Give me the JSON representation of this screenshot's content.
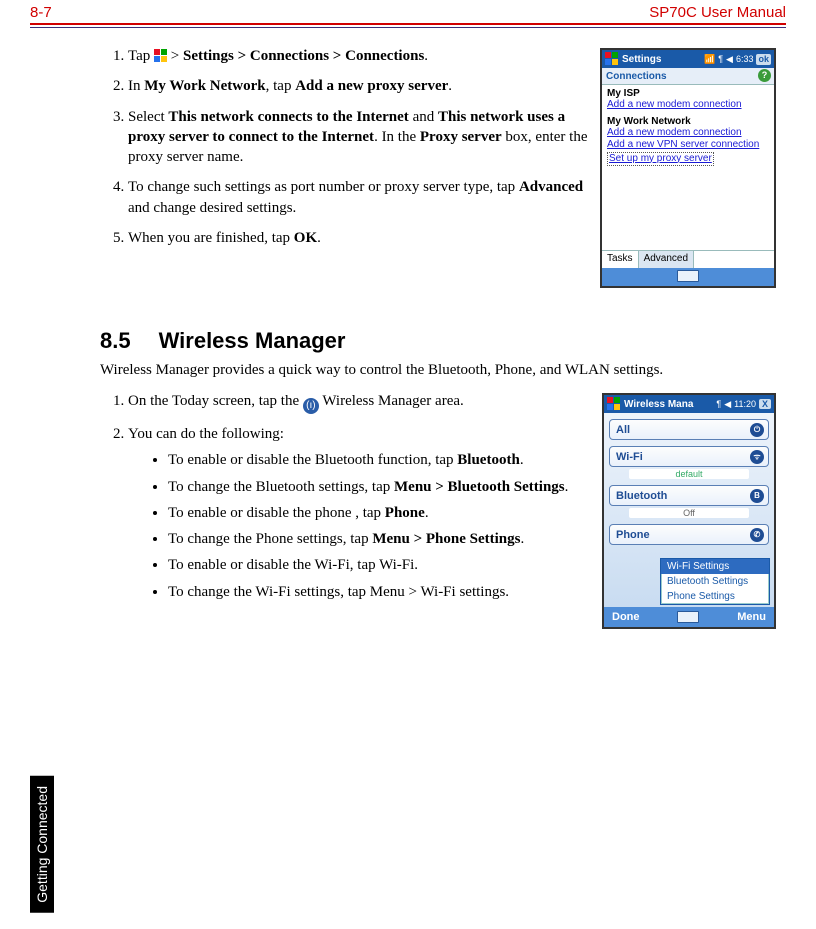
{
  "header": {
    "page": "8-7",
    "title": "SP70C User Manual"
  },
  "side_tab": "Getting Connected",
  "section1": {
    "steps": {
      "s1": {
        "pre": "Tap ",
        "post": " > ",
        "b1": "Settings > Connections > Connections",
        "end": "."
      },
      "s2": {
        "pre": "In ",
        "b1": "My Work Network",
        "mid": ", tap ",
        "b2": "Add a new proxy server",
        "end": "."
      },
      "s3": {
        "pre": "Select ",
        "b1": "This network connects to the Internet",
        "mid1": " and ",
        "b2": "This network uses a proxy server to connect to the Internet",
        "mid2": ". In the ",
        "b3": "Proxy server",
        "end": " box, enter the proxy server name."
      },
      "s4": {
        "pre": "To change such settings as port number or proxy server type, tap ",
        "b1": "Advanced",
        "end": " and change desired settings."
      },
      "s5": {
        "pre": "When you are finished, tap ",
        "b1": "OK",
        "end": "."
      }
    }
  },
  "section2": {
    "num": "8.5",
    "title": "Wireless Manager",
    "intro": "Wireless Manager provides a quick way to control the Bluetooth, Phone, and WLAN settings.",
    "steps": {
      "s1": {
        "pre": "On the Today screen, tap the ",
        "post": " Wireless Manager area."
      },
      "s2": {
        "text": "You can do the following:"
      }
    },
    "bullets": {
      "b1": {
        "pre": "To enable or disable the Bluetooth function, tap ",
        "bold": "Bluetooth",
        "end": "."
      },
      "b2": {
        "pre": "To change the Bluetooth settings, tap ",
        "bold": "Menu > Bluetooth Settings",
        "end": "."
      },
      "b3": {
        "pre": "To enable or disable the phone , tap ",
        "bold": "Phone",
        "end": "."
      },
      "b4": {
        "pre": "To change the Phone settings, tap ",
        "bold": "Menu > Phone Settings",
        "end": "."
      },
      "b5": {
        "text": "To enable or disable the Wi-Fi, tap Wi-Fi."
      },
      "b6": {
        "text": "To change the Wi-Fi settings, tap Menu > Wi-Fi settings."
      }
    }
  },
  "shot1": {
    "title": "Settings",
    "time": "6:33",
    "ok": "ok",
    "subtab": "Connections",
    "g1": {
      "h": "My ISP",
      "l1": "Add a new modem connection"
    },
    "g2": {
      "h": "My Work Network",
      "l1": "Add a new modem connection",
      "l2": "Add a new VPN server connection",
      "l3": "Set up my proxy server"
    },
    "tab1": "Tasks",
    "tab2": "Advanced"
  },
  "shot2": {
    "title": "Wireless Mana",
    "time": "11:20",
    "close": "X",
    "rows": {
      "all": "All",
      "wifi": "Wi-Fi",
      "wifi_sub": "default",
      "bt": "Bluetooth",
      "bt_sub": "Off",
      "phone": "Phone"
    },
    "menu": {
      "m1": "Wi-Fi Settings",
      "m2": "Bluetooth Settings",
      "m3": "Phone Settings"
    },
    "soft": {
      "left": "Done",
      "right": "Menu"
    }
  }
}
